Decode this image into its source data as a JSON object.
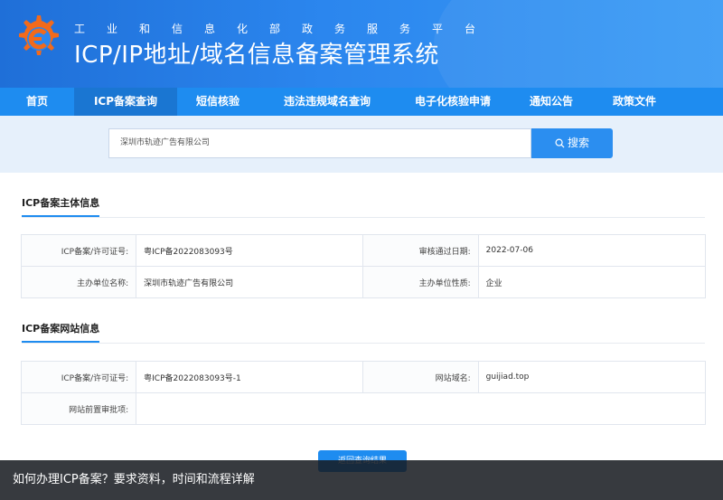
{
  "header": {
    "subtitle_chars": [
      "工",
      "业",
      "和",
      "信",
      "息",
      "化",
      "部",
      "政",
      "务",
      "服",
      "务",
      "平",
      "台"
    ],
    "title": "ICP/IP地址/域名信息备案管理系统",
    "brand_colors": {
      "primary": "#1e8cf0",
      "header_start": "#1f6fd8",
      "logo_orange": "#f26a1b"
    }
  },
  "nav": {
    "items": [
      {
        "label": "首页"
      },
      {
        "label": "ICP备案查询"
      },
      {
        "label": "短信核验"
      },
      {
        "label": "违法违规域名查询"
      },
      {
        "label": "电子化核验申请"
      },
      {
        "label": "通知公告"
      },
      {
        "label": "政策文件"
      }
    ],
    "active_index": 1
  },
  "search": {
    "value": "深圳市轨迹广告有限公司",
    "button_label": "搜索",
    "icon": "search-icon"
  },
  "subject_section": {
    "title": "ICP备案主体信息",
    "rows": [
      {
        "label1": "ICP备案/许可证号:",
        "value1": "粤ICP备2022083093号",
        "label2": "审核通过日期:",
        "value2": "2022-07-06"
      },
      {
        "label1": "主办单位名称:",
        "value1": "深圳市轨迹广告有限公司",
        "label2": "主办单位性质:",
        "value2": "企业"
      }
    ]
  },
  "website_section": {
    "title": "ICP备案网站信息",
    "row1": {
      "label1": "ICP备案/许可证号:",
      "value1": "粤ICP备2022083093号-1",
      "label2": "网站域名:",
      "value2": "guijiad.top"
    },
    "row2": {
      "label1": "网站前置审批项:",
      "value1": ""
    }
  },
  "return_button": {
    "label": "返回查询结果"
  },
  "caption": {
    "text": "如何办理ICP备案？要求资料，时间和流程详解"
  }
}
